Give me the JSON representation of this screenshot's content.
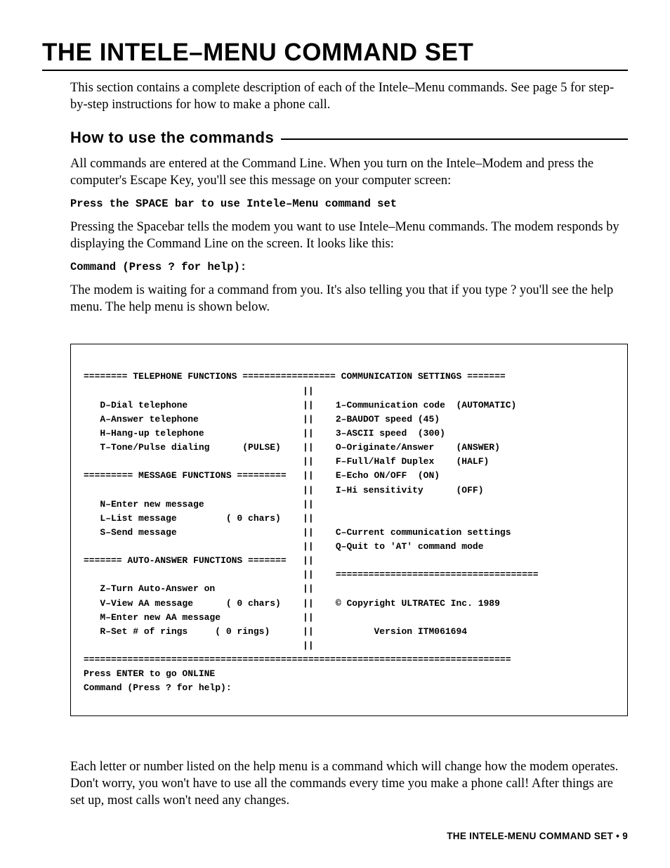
{
  "title": "THE INTELE–MENU COMMAND SET",
  "intro": "This section contains a complete description of each of the Intele–Menu commands. See page 5 for step-by-step instructions for how to make a phone call.",
  "section_heading": "How to use the commands",
  "para1": "All commands are entered at the Command Line. When you turn on the Intele–Modem and press the computer's Escape Key, you'll see this message on your computer screen:",
  "mono1": "Press the SPACE bar to use Intele–Menu command set",
  "para2": "Pressing the Spacebar tells the modem you want to use Intele–Menu commands. The modem responds by displaying the Command Line on the screen. It looks like this:",
  "mono2": "Command (Press ? for help):",
  "para3": "The modem is waiting for a command from you. It's also telling you that if you type ? you'll see the help menu. The help menu is shown below.",
  "terminal": "======== TELEPHONE FUNCTIONS ================= COMMUNICATION SETTINGS =======\n                                        ||\n   D–Dial telephone                     ||    1–Communication code  (AUTOMATIC)\n   A–Answer telephone                   ||    2–BAUDOT speed (45)\n   H–Hang-up telephone                  ||    3–ASCII speed  (300)\n   T–Tone/Pulse dialing      (PULSE)    ||    O–Originate/Answer    (ANSWER)\n                                        ||    F–Full/Half Duplex    (HALF)\n========= MESSAGE FUNCTIONS =========   ||    E–Echo ON/OFF  (ON)\n                                        ||    I–Hi sensitivity      (OFF)\n   N–Enter new message                  ||\n   L–List message         ( 0 chars)    ||\n   S–Send message                       ||    C–Current communication settings\n                                        ||    Q–Quit to 'AT' command mode\n======= AUTO-ANSWER FUNCTIONS =======   ||\n                                        ||    =====================================\n   Z–Turn Auto-Answer on                ||\n   V–View AA message      ( 0 chars)    ||    © Copyright ULTRATEC Inc. 1989\n   M–Enter new AA message               ||\n   R–Set # of rings     ( 0 rings)      ||           Version ITM061694\n                                        ||\n==============================================================================\nPress ENTER to go ONLINE\nCommand (Press ? for help):",
  "outro": "Each letter or number listed on the help menu is a command which will change how the modem operates. Don't worry, you won't have to use all the commands every time you make a phone call! After things are set up, most calls won't need any changes.",
  "footer": "THE INTELE-MENU COMMAND SET • 9"
}
